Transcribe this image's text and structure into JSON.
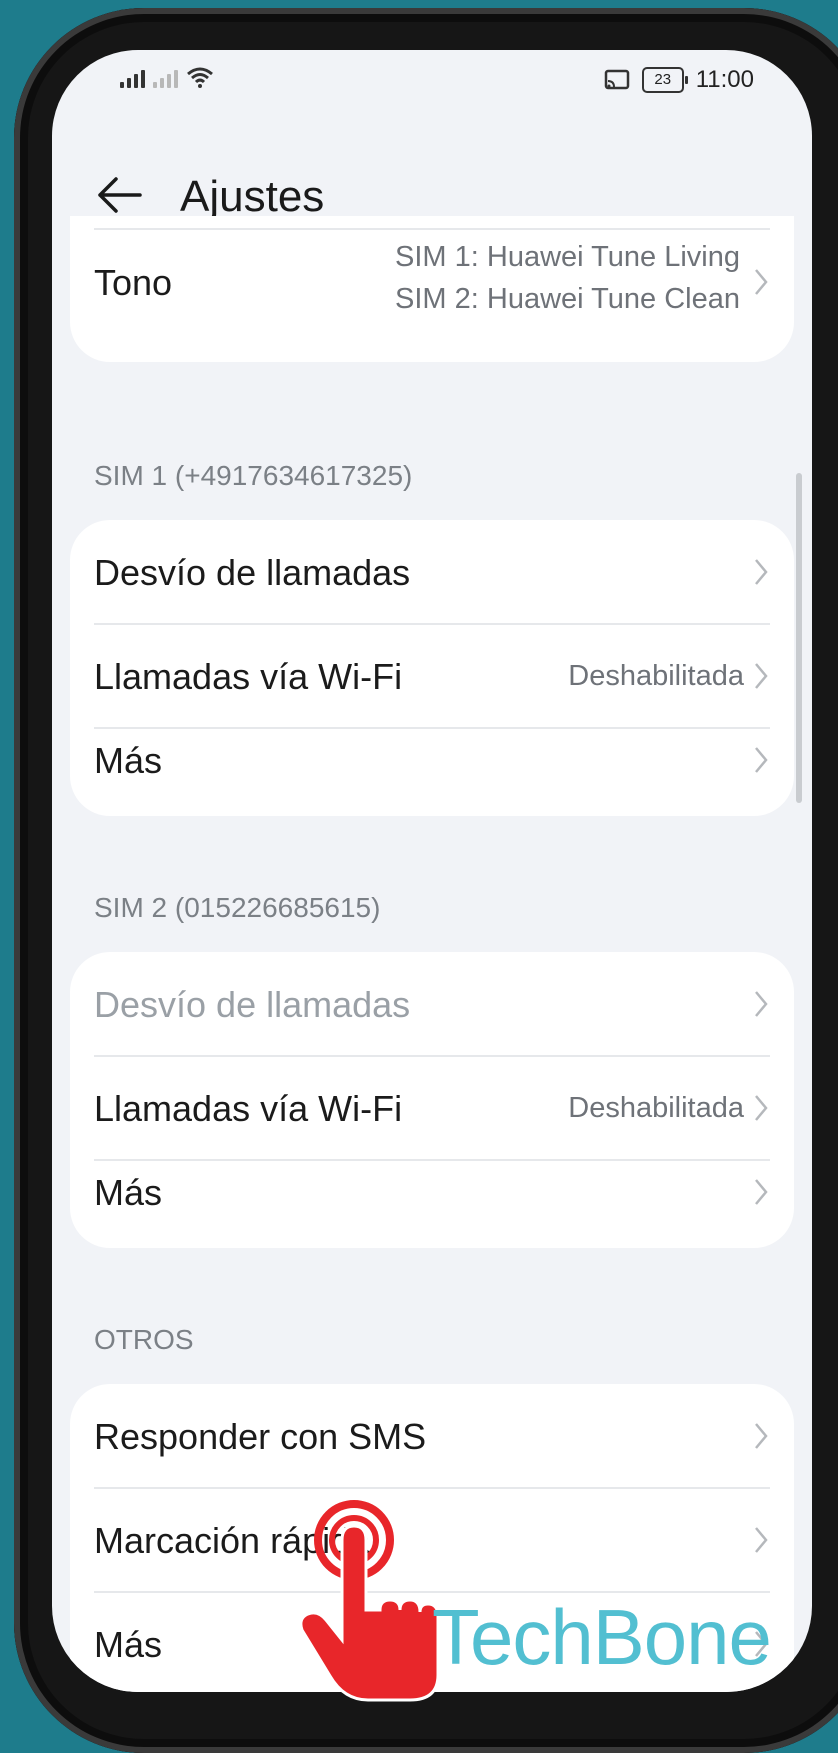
{
  "status_bar": {
    "time": "11:00",
    "battery": "23"
  },
  "header": {
    "title": "Ajustes"
  },
  "tone": {
    "label": "Tono",
    "sim1": "SIM 1: Huawei Tune Living",
    "sim2": "SIM 2: Huawei Tune Clean"
  },
  "sim1": {
    "section_title": "SIM 1 (+4917634617325)",
    "items": [
      {
        "label": "Desvío de llamadas",
        "value": ""
      },
      {
        "label": "Llamadas vía Wi-Fi",
        "value": "Deshabilitada"
      },
      {
        "label": "Más",
        "value": ""
      }
    ]
  },
  "sim2": {
    "section_title": "SIM 2 (015226685615)",
    "items": [
      {
        "label": "Desvío de llamadas",
        "value": ""
      },
      {
        "label": "Llamadas vía Wi-Fi",
        "value": "Deshabilitada"
      },
      {
        "label": "Más",
        "value": ""
      }
    ]
  },
  "others": {
    "section_title": "OTROS",
    "items": [
      {
        "label": "Responder con SMS"
      },
      {
        "label": "Marcación rápida"
      },
      {
        "label": "Más"
      }
    ]
  },
  "overlay": {
    "watermark": "TechBone",
    "tap_icon": "tap-hand-icon",
    "tap_color": "#e8262a"
  },
  "colors": {
    "background": "#1e7c8c",
    "screen": "#f1f3f7",
    "card": "#ffffff"
  }
}
